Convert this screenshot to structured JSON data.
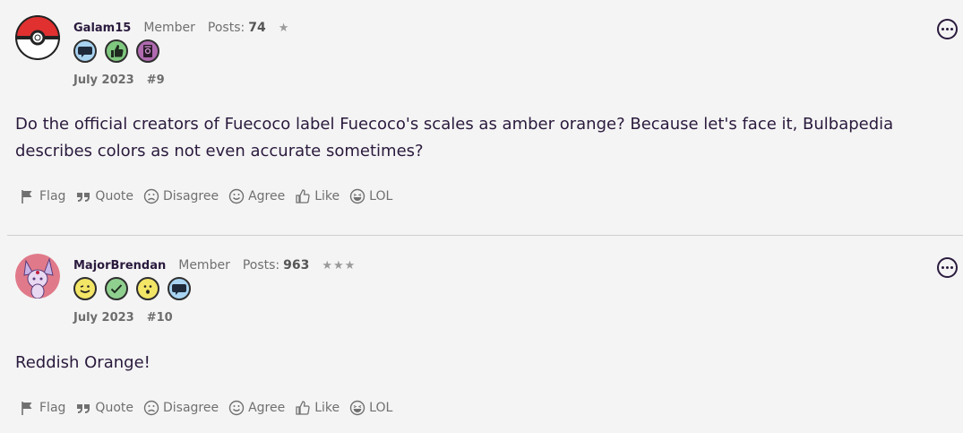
{
  "posts": [
    {
      "username": "Galam15",
      "role": "Member",
      "posts_label": "Posts:",
      "posts_count": "74",
      "stars": "★",
      "date": "July 2023",
      "number": "#9",
      "content": "Do the official creators of Fuecoco label Fuecoco's scales as amber orange? Because let's face it, Bulbapedia describes colors as not even accurate sometimes?",
      "badges": [
        "speech-bubble-icon",
        "thumbs-up-icon",
        "notebook-icon"
      ],
      "avatar": "pokeball-icon"
    },
    {
      "username": "MajorBrendan",
      "role": "Member",
      "posts_label": "Posts:",
      "posts_count": "963",
      "stars": "★★★",
      "date": "July 2023",
      "number": "#10",
      "content": "Reddish Orange!",
      "badges": [
        "wink-face-icon",
        "checkmark-icon",
        "surprised-face-icon",
        "speech-bubble-icon"
      ],
      "avatar": "espeon-icon"
    }
  ],
  "actions": {
    "flag": "Flag",
    "quote": "Quote",
    "disagree": "Disagree",
    "agree": "Agree",
    "like": "Like",
    "lol": "LOL"
  },
  "colors": {
    "text": "#2a1a3d",
    "muted": "#707070",
    "background": "#f4f4f4",
    "divider": "#cfcfcf"
  }
}
